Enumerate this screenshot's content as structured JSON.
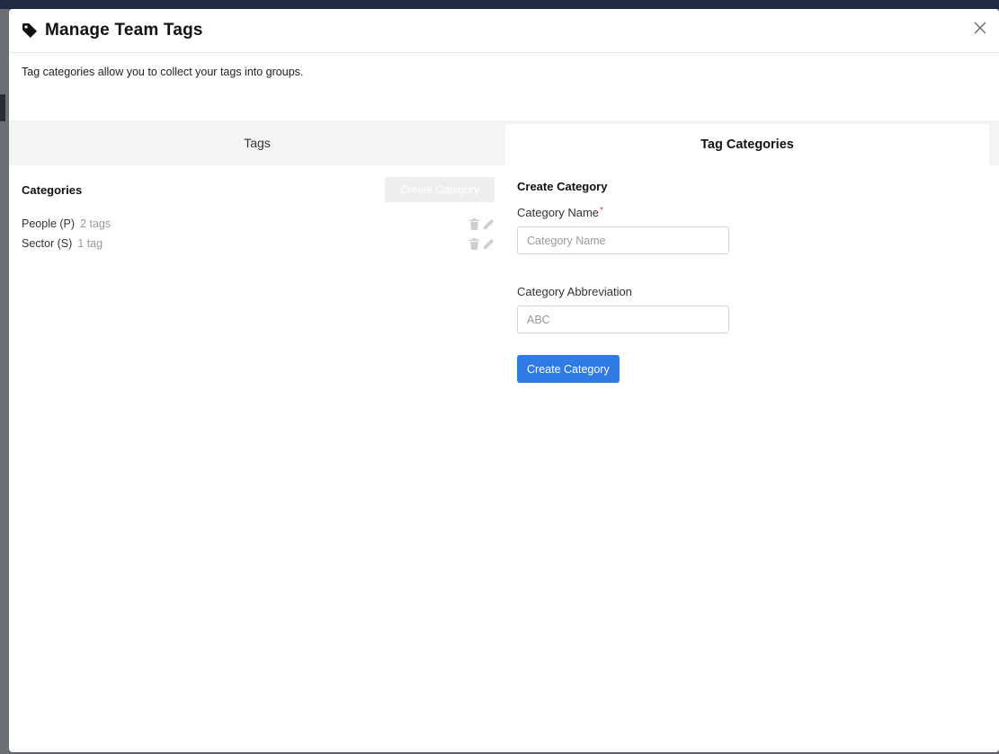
{
  "modal": {
    "title": "Manage Team Tags",
    "description": "Tag categories allow you to collect your tags into groups."
  },
  "tabs": [
    {
      "label": "Tags",
      "active": false
    },
    {
      "label": "Tag Categories",
      "active": true
    }
  ],
  "categories_panel": {
    "title": "Categories",
    "create_button_label": "Create Category",
    "items": [
      {
        "name": "People (P)",
        "count": "2 tags"
      },
      {
        "name": "Sector (S)",
        "count": "1 tag"
      }
    ]
  },
  "create_form": {
    "title": "Create Category",
    "name_label": "Category Name",
    "name_required": "*",
    "name_placeholder": "Category Name",
    "name_value": "",
    "abbr_label": "Category Abbreviation",
    "abbr_placeholder": "ABC",
    "abbr_value": "",
    "submit_label": "Create Category"
  },
  "icons": {
    "title": "tag-icon",
    "close": "close-icon",
    "delete": "trash-icon",
    "edit": "pencil-icon"
  },
  "colors": {
    "primary": "#2f7be5",
    "required": "#e53935",
    "muted": "#999999"
  }
}
